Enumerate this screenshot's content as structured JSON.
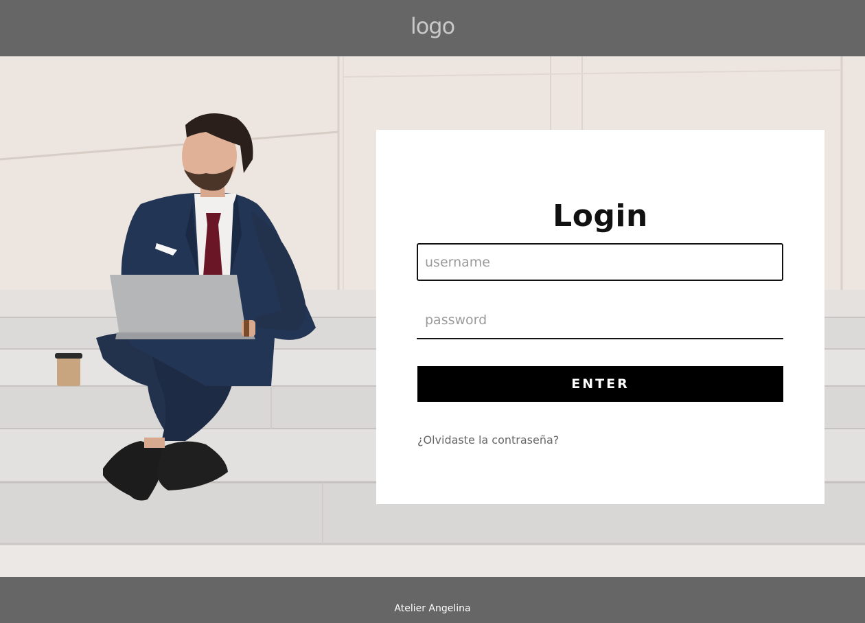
{
  "header": {
    "logo_text": "logo"
  },
  "hero": {
    "image": "man-in-suit-with-laptop-on-stairs"
  },
  "login": {
    "title": "Login",
    "username_placeholder": "username",
    "username_value": "",
    "password_placeholder": "password",
    "password_value": "",
    "enter_label": "ENTER",
    "forgot_link": "¿Olvidaste la contraseña?"
  },
  "footer": {
    "text": "Atelier Angelina"
  },
  "colors": {
    "header_bg": "#666666",
    "button_bg": "#000000",
    "card_bg": "#ffffff"
  }
}
